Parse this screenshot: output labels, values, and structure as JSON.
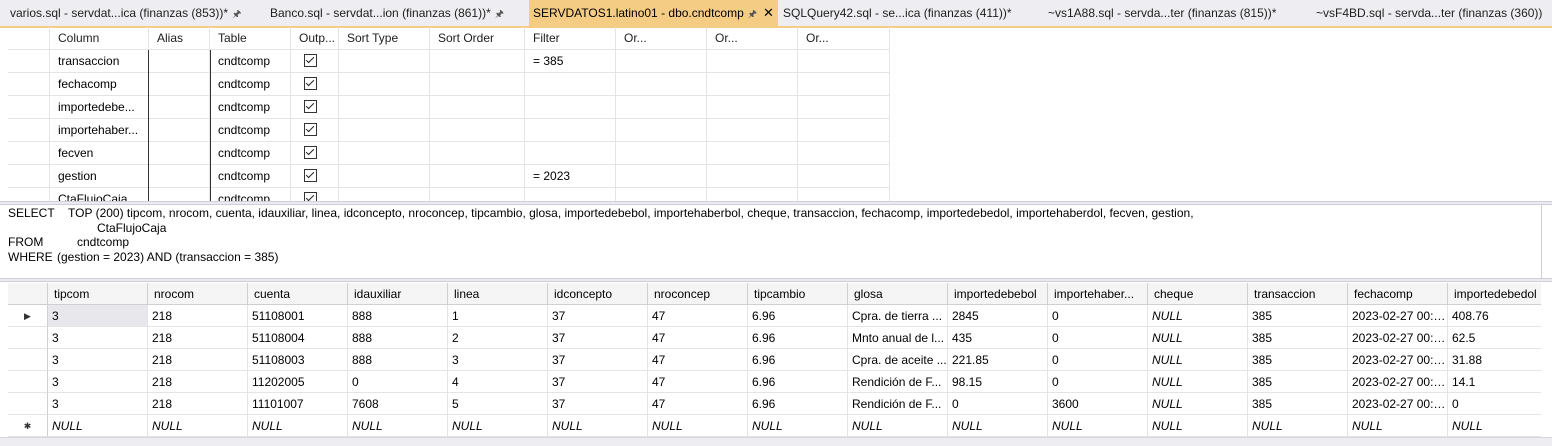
{
  "tabs": [
    {
      "label": "varios.sql - servdat...ica (finanzas (853))*",
      "pinned": true,
      "active": false
    },
    {
      "label": "Banco.sql - servdat...ion (finanzas (861))*",
      "pinned": true,
      "active": false
    },
    {
      "label": "SERVDATOS1.latino01 - dbo.cndtcomp",
      "pinned": true,
      "active": true
    },
    {
      "label": "SQLQuery42.sql - se...ica (finanzas (411))*",
      "pinned": false,
      "active": false
    },
    {
      "label": "~vs1A88.sql - servda...ter (finanzas (815))*",
      "pinned": false,
      "active": false
    },
    {
      "label": "~vsF4BD.sql - servda...ter (finanzas (360))",
      "pinned": false,
      "active": false
    }
  ],
  "criteria": {
    "headers": [
      "Column",
      "Alias",
      "Table",
      "Outp...",
      "Sort Type",
      "Sort Order",
      "Filter",
      "Or...",
      "Or...",
      "Or..."
    ],
    "rows": [
      {
        "column": "transaccion",
        "alias": "",
        "table": "cndtcomp",
        "output": true,
        "sort_type": "",
        "sort_order": "",
        "filter": "= 385"
      },
      {
        "column": "fechacomp",
        "alias": "",
        "table": "cndtcomp",
        "output": true,
        "sort_type": "",
        "sort_order": "",
        "filter": ""
      },
      {
        "column": "importedebe...",
        "alias": "",
        "table": "cndtcomp",
        "output": true,
        "sort_type": "",
        "sort_order": "",
        "filter": ""
      },
      {
        "column": "importehaber...",
        "alias": "",
        "table": "cndtcomp",
        "output": true,
        "sort_type": "",
        "sort_order": "",
        "filter": ""
      },
      {
        "column": "fecven",
        "alias": "",
        "table": "cndtcomp",
        "output": true,
        "sort_type": "",
        "sort_order": "",
        "filter": ""
      },
      {
        "column": "gestion",
        "alias": "",
        "table": "cndtcomp",
        "output": true,
        "sort_type": "",
        "sort_order": "",
        "filter": "= 2023"
      },
      {
        "column": "CtaFlujoCaja",
        "alias": "",
        "table": "cndtcomp",
        "output": true,
        "sort_type": "",
        "sort_order": "",
        "filter": ""
      }
    ]
  },
  "sql": {
    "select_kw": "SELECT",
    "select_line1": "TOP (200) tipcom, nrocom, cuenta, idauxiliar, linea, idconcepto, nroconcep, tipcambio, glosa, importedebebol, importehaberbol, cheque, transaccion, fechacomp, importedebedol, importehaberdol, fecven, gestion,",
    "select_line2": "CtaFlujoCaja",
    "from_kw": "FROM",
    "from_text": "cndtcomp",
    "where_kw": "WHERE",
    "where_text": "(gestion = 2023) AND (transaccion = 385)"
  },
  "results": {
    "headers": [
      "tipcom",
      "nrocom",
      "cuenta",
      "idauxiliar",
      "linea",
      "idconcepto",
      "nroconcep",
      "tipcambio",
      "glosa",
      "importedebebol",
      "importehaber...",
      "cheque",
      "transaccion",
      "fechacomp",
      "importedebedol"
    ],
    "rows": [
      [
        "3",
        "218",
        "51108001",
        "888",
        "1",
        "37",
        "47",
        "6.96",
        "Cpra. de tierra ...",
        "2845",
        "0",
        "NULL",
        "385",
        "2023-02-27 00:0...",
        "408.76"
      ],
      [
        "3",
        "218",
        "51108004",
        "888",
        "2",
        "37",
        "47",
        "6.96",
        "Mnto anual de l...",
        "435",
        "0",
        "NULL",
        "385",
        "2023-02-27 00:0...",
        "62.5"
      ],
      [
        "3",
        "218",
        "51108003",
        "888",
        "3",
        "37",
        "47",
        "6.96",
        "Cpra. de aceite ...",
        "221.85",
        "0",
        "NULL",
        "385",
        "2023-02-27 00:0...",
        "31.88"
      ],
      [
        "3",
        "218",
        "11202005",
        "0",
        "4",
        "37",
        "47",
        "6.96",
        "Rendición de F...",
        "98.15",
        "0",
        "NULL",
        "385",
        "2023-02-27 00:0...",
        "14.1"
      ],
      [
        "3",
        "218",
        "11101007",
        "7608",
        "5",
        "37",
        "47",
        "6.96",
        "Rendición de F...",
        "0",
        "3600",
        "NULL",
        "385",
        "2023-02-27 00:0...",
        "0"
      ]
    ],
    "new_row": [
      "NULL",
      "NULL",
      "NULL",
      "NULL",
      "NULL",
      "NULL",
      "NULL",
      "NULL",
      "NULL",
      "NULL",
      "NULL",
      "NULL",
      "NULL",
      "NULL",
      "NULL"
    ],
    "current_row_marker": "▶",
    "new_row_marker": "✱"
  }
}
